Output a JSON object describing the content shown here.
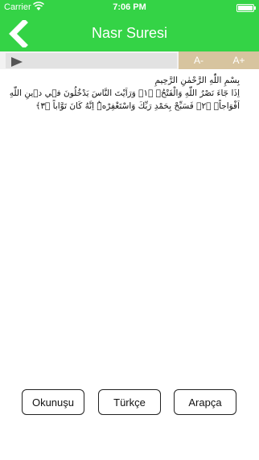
{
  "status_bar": {
    "carrier": "Carrier",
    "time": "7:06 PM",
    "battery_level": 1.0
  },
  "nav": {
    "title": "Nasr Suresi",
    "back_icon": "chevron-left-icon",
    "background_color": "#34d346"
  },
  "player": {
    "progress": 0.0,
    "play_icon": "play-icon",
    "font_decrease_label": "A-",
    "font_increase_label": "A+",
    "font_button_color": "#d7c49f"
  },
  "content": {
    "lines": [
      "بِسْمِ اللّٰهِ الرَّحْمٰنِ الرَّحِيمِ",
      "اِذَا جَٓاءَ نَصْرُ اللّٰهِ وَالْفَتْحُۙ ﴿١﴾ وَرَاَيْتَ النَّاسَ يَدْخُلُونَ ف۪ي د۪ينِ اللّٰهِ اَفْوَاجاًۙ ﴿٢﴾ فَسَبِّحْ بِحَمْدِ رَبِّكَ وَاسْتَغْفِرْهُۜ اِنَّهُ كَانَ تَوَّاباً ﴿٣﴾"
    ]
  },
  "bottom_buttons": {
    "okunusu": "Okunuşu",
    "turkce": "Türkçe",
    "arapca": "Arapça"
  }
}
